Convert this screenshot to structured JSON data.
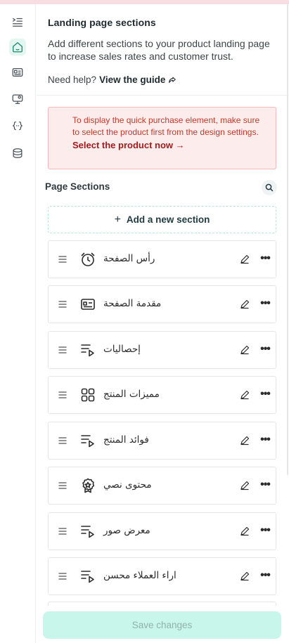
{
  "header": {
    "title": "Landing page sections",
    "description": "Add different sections to your product landing page to increase sales rates and customer trust.",
    "help_prefix": "Need help?",
    "help_link": "View the guide"
  },
  "alert": {
    "message": "To display the quick purchase element, make sure to select the product first from the design settings.",
    "action": "Select the product now →"
  },
  "sections": {
    "title": "Page Sections",
    "add_label": "Add a new section",
    "items": [
      {
        "label": "رأس الصفحة",
        "icon": "alarm-clock-icon"
      },
      {
        "label": "مقدمة الصفحة",
        "icon": "id-card-icon"
      },
      {
        "label": "إحصاليات",
        "icon": "playlist-icon"
      },
      {
        "label": "مميزات المنتج",
        "icon": "grid-icon"
      },
      {
        "label": "فوائد المنتج",
        "icon": "playlist-icon"
      },
      {
        "label": "محتوى نصي",
        "icon": "award-icon"
      },
      {
        "label": "معرض صور",
        "icon": "playlist-icon"
      },
      {
        "label": "اراء العملاء محسن",
        "icon": "playlist-icon"
      }
    ]
  },
  "footer": {
    "save_label": "Save changes"
  },
  "colors": {
    "accent": "#c9f6ea",
    "alert_bg": "#fdecec",
    "alert_text": "#c0392b"
  }
}
